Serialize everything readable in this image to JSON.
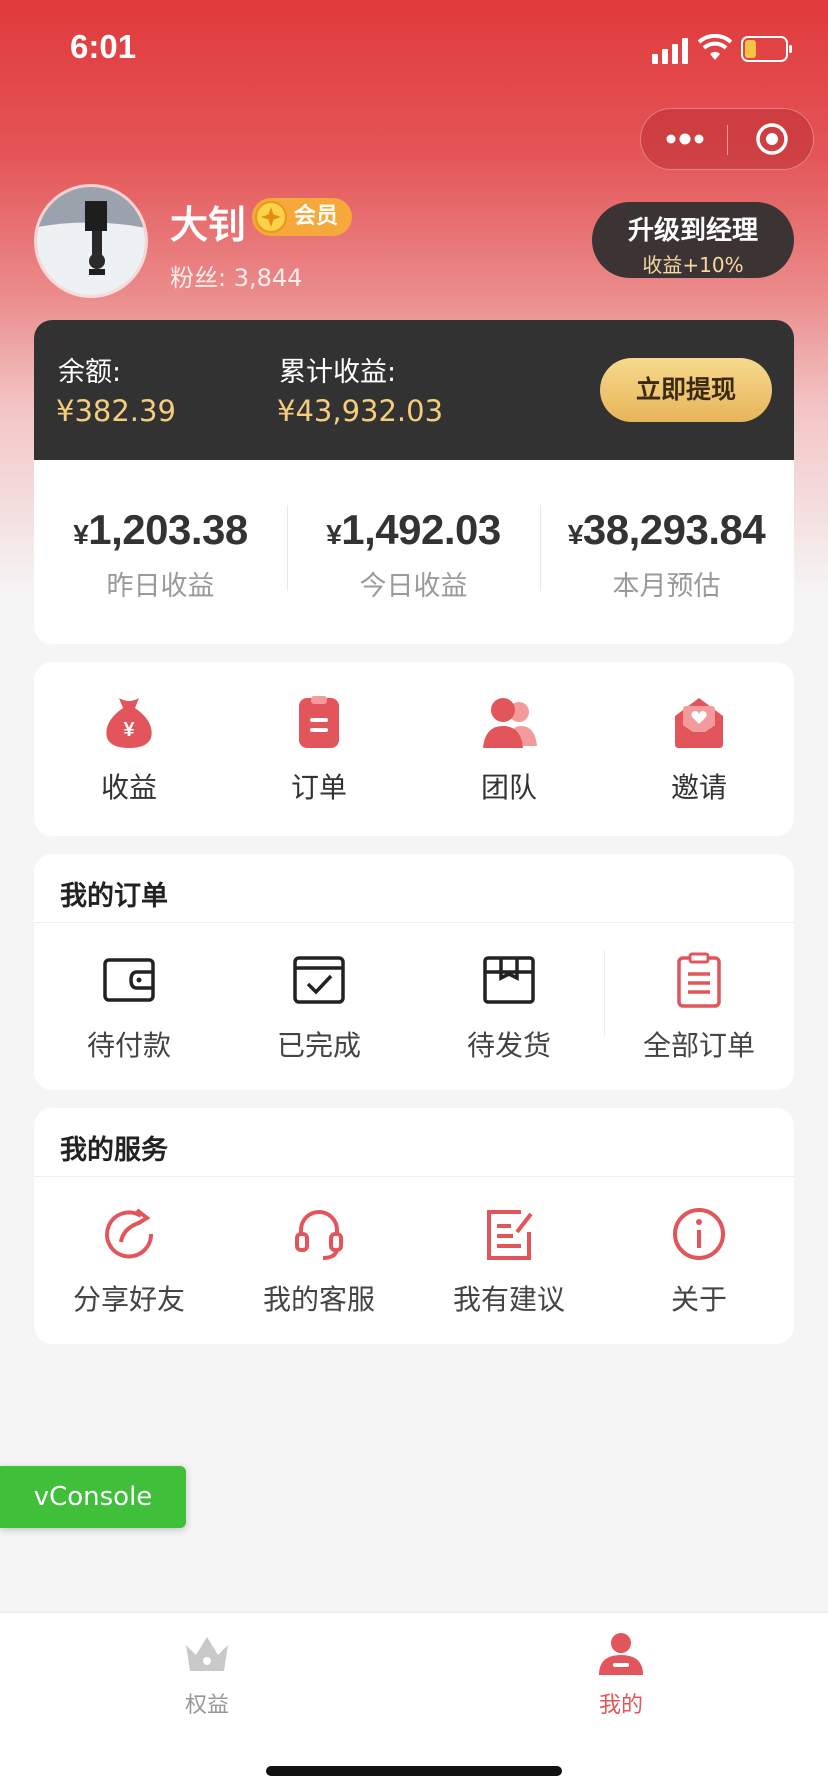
{
  "status_bar": {
    "time": "6:01"
  },
  "profile": {
    "name": "大钊",
    "badge": "会员",
    "fans": "粉丝: 3,844",
    "upgrade_title": "升级到经理",
    "upgrade_sub": "收益+10%"
  },
  "balance": {
    "balance_label": "余额:",
    "balance_value": "¥382.39",
    "total_label": "累计收益:",
    "total_value": "¥43,932.03",
    "withdraw_label": "立即提现"
  },
  "stats": [
    {
      "currency": "¥",
      "value": "1,203.38",
      "label": "昨日收益"
    },
    {
      "currency": "¥",
      "value": "1,492.03",
      "label": "今日收益"
    },
    {
      "currency": "¥",
      "value": "38,293.84",
      "label": "本月预估"
    }
  ],
  "shortcuts": [
    {
      "label": "收益",
      "icon": "money-bag-icon"
    },
    {
      "label": "订单",
      "icon": "clipboard-icon"
    },
    {
      "label": "团队",
      "icon": "team-icon"
    },
    {
      "label": "邀请",
      "icon": "invite-envelope-icon"
    }
  ],
  "orders": {
    "title": "我的订单",
    "items": [
      {
        "label": "待付款",
        "icon": "wallet-icon"
      },
      {
        "label": "已完成",
        "icon": "check-box-icon"
      },
      {
        "label": "待发货",
        "icon": "package-icon"
      },
      {
        "label": "全部订单",
        "icon": "order-list-icon"
      }
    ]
  },
  "services": {
    "title": "我的服务",
    "items": [
      {
        "label": "分享好友",
        "icon": "share-icon"
      },
      {
        "label": "我的客服",
        "icon": "headset-icon"
      },
      {
        "label": "我有建议",
        "icon": "feedback-icon"
      },
      {
        "label": "关于",
        "icon": "info-icon"
      }
    ]
  },
  "vconsole": {
    "label": "vConsole"
  },
  "tabbar": {
    "items": [
      {
        "label": "权益",
        "icon": "crown-icon",
        "active": false
      },
      {
        "label": "我的",
        "icon": "person-icon",
        "active": true
      }
    ]
  },
  "colors": {
    "brand_red": "#e03a3c",
    "icon_red": "#e2555a",
    "gold": "#f5cd7c",
    "dark_panel": "#333232",
    "vconsole_green": "#3fbf3a"
  }
}
